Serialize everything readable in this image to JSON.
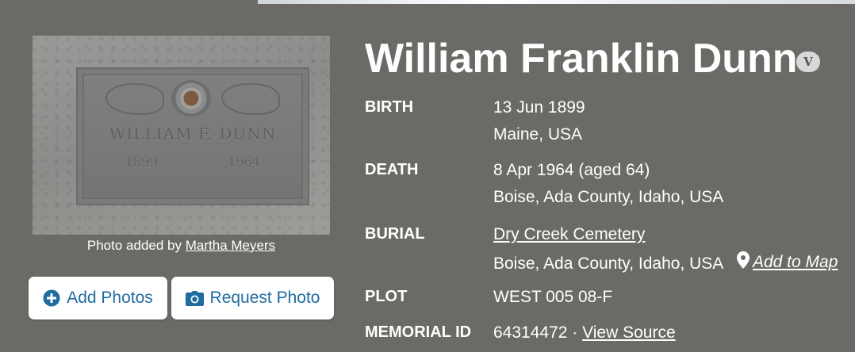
{
  "photo": {
    "engraving_name": "WILLIAM F. DUNN",
    "engraving_birth_year": "1899",
    "engraving_death_year": "1964",
    "caption_prefix": "Photo added by",
    "caption_author": "Martha Meyers"
  },
  "buttons": {
    "add_photos": "Add Photos",
    "request_photo": "Request Photo"
  },
  "person": {
    "name": "William Franklin Dunn",
    "badge": "V"
  },
  "facts": {
    "birth_label": "BIRTH",
    "birth_date": "13 Jun 1899",
    "birth_place": "Maine, USA",
    "death_label": "DEATH",
    "death_date": "8 Apr 1964 (aged 64)",
    "death_place": "Boise, Ada County, Idaho, USA",
    "burial_label": "BURIAL",
    "burial_cemetery": "Dry Creek Cemetery",
    "burial_place": "Boise, Ada County, Idaho, USA",
    "add_to_map": "Add to Map",
    "plot_label": "PLOT",
    "plot_value": "WEST 005 08-F",
    "memorial_label": "MEMORIAL ID",
    "memorial_id": "64314472",
    "separator": "·",
    "view_source": "View Source"
  },
  "colors": {
    "background": "#6b6a66",
    "button_text": "#1f6c9e"
  },
  "icons": [
    "plus-circle-icon",
    "camera-icon",
    "map-pin-icon"
  ]
}
